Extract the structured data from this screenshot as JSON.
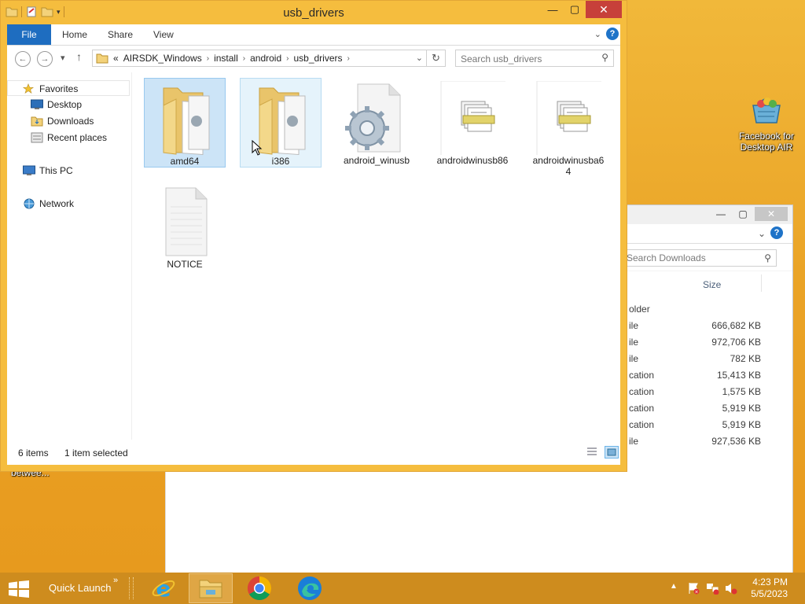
{
  "desktop": {
    "icon_label": "Facebook for Desktop AIR",
    "left_label": "betwee..."
  },
  "back_window": {
    "search_placeholder": "Search Downloads",
    "size_header": "Size",
    "rows": [
      {
        "type": "older",
        "size": ""
      },
      {
        "type": "ile",
        "size": "666,682 KB"
      },
      {
        "type": "ile",
        "size": "972,706 KB"
      },
      {
        "type": "ile",
        "size": "782 KB"
      },
      {
        "type": "cation",
        "size": "15,413 KB"
      },
      {
        "type": "cation",
        "size": "1,575 KB"
      },
      {
        "type": "cation",
        "size": "5,919 KB"
      },
      {
        "type": "cation",
        "size": "5,919 KB"
      },
      {
        "type": "ile",
        "size": "927,536 KB"
      }
    ]
  },
  "window": {
    "title": "usb_drivers",
    "ribbon": {
      "file": "File",
      "home": "Home",
      "share": "Share",
      "view": "View",
      "help": "?"
    },
    "address": {
      "prefix": "«",
      "crumbs": [
        "AIRSDK_Windows",
        "install",
        "android",
        "usb_drivers"
      ]
    },
    "search_placeholder": "Search usb_drivers",
    "nav": {
      "favorites": "Favorites",
      "desktop": "Desktop",
      "downloads": "Downloads",
      "recent": "Recent places",
      "thispc": "This PC",
      "network": "Network"
    },
    "files": [
      {
        "name": "amd64",
        "kind": "folder",
        "state": "selected"
      },
      {
        "name": "i386",
        "kind": "folder",
        "state": "hover"
      },
      {
        "name": "android_winusb",
        "kind": "settings"
      },
      {
        "name": "androidwinusb86",
        "kind": "catalog"
      },
      {
        "name": "androidwinusba6 4",
        "kind": "catalog"
      },
      {
        "name": "NOTICE",
        "kind": "text"
      }
    ],
    "status": {
      "count": "6 items",
      "selection": "1 item selected"
    }
  },
  "taskbar": {
    "quick_launch": "Quick Launch",
    "time": "4:23 PM",
    "date": "5/5/2023"
  },
  "colors": {
    "accent": "#1e6dc0",
    "desktop": "#eaa326",
    "taskbar": "#ce8c1e",
    "close": "#c7403a"
  }
}
